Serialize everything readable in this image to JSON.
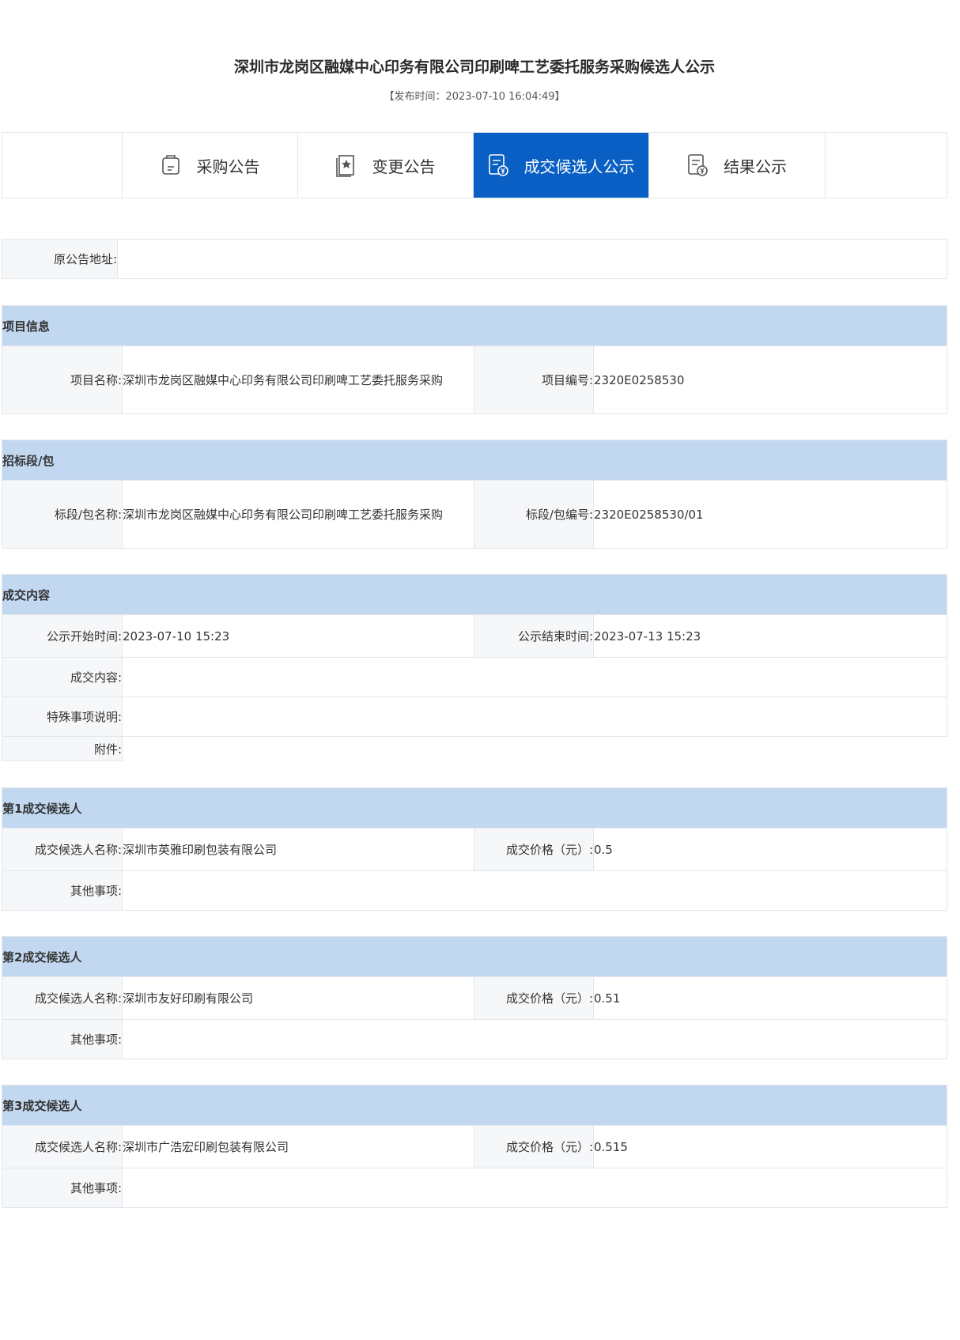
{
  "header": {
    "title": "深圳市龙岗区融媒中心印务有限公司印刷啤工艺委托服务采购候选人公示",
    "publish_time": "【发布时间：2023-07-10 16:04:49】"
  },
  "tabs": [
    {
      "label": "采购公告",
      "icon": "procurement-notice-icon",
      "active": false
    },
    {
      "label": "变更公告",
      "icon": "change-notice-icon",
      "active": false
    },
    {
      "label": "成交候选人公示",
      "icon": "candidate-notice-icon",
      "active": true
    },
    {
      "label": "结果公示",
      "icon": "result-notice-icon",
      "active": false
    }
  ],
  "original": {
    "label": "原公告地址:",
    "value": ""
  },
  "project": {
    "heading": "项目信息",
    "name_label": "项目名称:",
    "name_value": "深圳市龙岗区融媒中心印务有限公司印刷啤工艺委托服务采购",
    "code_label": "项目编号:",
    "code_value": "2320E0258530"
  },
  "package": {
    "heading": "招标段/包",
    "name_label": "标段/包名称:",
    "name_value": "深圳市龙岗区融媒中心印务有限公司印刷啤工艺委托服务采购",
    "code_label": "标段/包编号:",
    "code_value": "2320E0258530/01"
  },
  "deal": {
    "heading": "成交内容",
    "start_label": "公示开始时间:",
    "start_value": "2023-07-10 15:23",
    "end_label": "公示结束时间:",
    "end_value": "2023-07-13 15:23",
    "content_label": "成交内容:",
    "special_label": "特殊事项说明:",
    "attach_label": "附件:"
  },
  "candidates": [
    {
      "heading": "第1成交候选人",
      "name_label": "成交候选人名称:",
      "name": "深圳市英雅印刷包装有限公司",
      "price_label": "成交价格（元）:",
      "price": "0.5",
      "other_label": "其他事项:"
    },
    {
      "heading": "第2成交候选人",
      "name_label": "成交候选人名称:",
      "name": "深圳市友好印刷有限公司",
      "price_label": "成交价格（元）:",
      "price": "0.51",
      "other_label": "其他事项:"
    },
    {
      "heading": "第3成交候选人",
      "name_label": "成交候选人名称:",
      "name": "深圳市广浩宏印刷包装有限公司",
      "price_label": "成交价格（元）:",
      "price": "0.515",
      "other_label": "其他事项:"
    }
  ],
  "colors": {
    "accent": "#0a5fc4",
    "section_header": "#c2d7f0",
    "label_bg": "#f6f7f9",
    "border": "#e3e6ea"
  }
}
